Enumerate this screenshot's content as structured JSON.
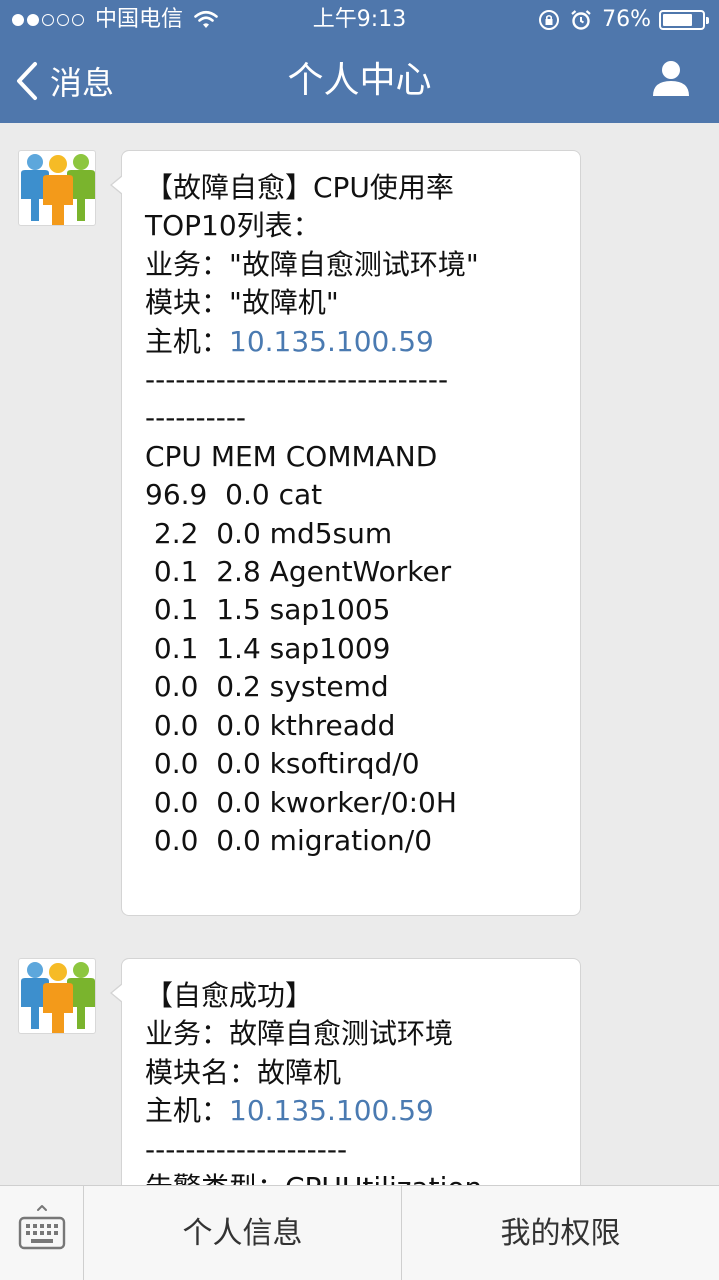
{
  "status_bar": {
    "carrier": "中国电信",
    "time": "上午9:13",
    "battery_percent": "76%",
    "battery_level": 0.76,
    "signal_bars_filled": 2,
    "signal_bars_total": 5
  },
  "navbar": {
    "back_label": "消息",
    "title": "个人中心",
    "user_icon": "person-icon"
  },
  "messages": [
    {
      "lines": [
        {
          "text": "【故障自愈】CPU使用率"
        },
        {
          "text": "TOP10列表："
        },
        {
          "text": "业务：\"故障自愈测试环境\""
        },
        {
          "text": "模块：\"故障机\""
        },
        {
          "prefix": "主机：",
          "link": "10.135.100.59"
        },
        {
          "text": "------------------------------"
        },
        {
          "text": "----------"
        },
        {
          "text": "CPU MEM COMMAND"
        },
        {
          "text": "96.9  0.0 cat"
        },
        {
          "text": " 2.2  0.0 md5sum"
        },
        {
          "text": " 0.1  2.8 AgentWorker"
        },
        {
          "text": " 0.1  1.5 sap1005"
        },
        {
          "text": " 0.1  1.4 sap1009"
        },
        {
          "text": " 0.0  0.2 systemd"
        },
        {
          "text": " 0.0  0.0 kthreadd"
        },
        {
          "text": " 0.0  0.0 ksoftirqd/0"
        },
        {
          "text": " 0.0  0.0 kworker/0:0H"
        },
        {
          "text": " 0.0  0.0 migration/0"
        }
      ]
    },
    {
      "lines": [
        {
          "text": "【自愈成功】"
        },
        {
          "text": "业务：故障自愈测试环境"
        },
        {
          "text": "模块名：故障机"
        },
        {
          "prefix": "主机：",
          "link": "10.135.100.59"
        },
        {
          "text": "--------------------"
        },
        {
          "text": "告警类型：CPUUtilization"
        }
      ]
    }
  ],
  "bottom_menu": {
    "keyboard_icon": "keyboard-icon",
    "item_1": "个人信息",
    "item_2": "我的权限"
  },
  "colors": {
    "navbar": "#4f77ac",
    "link": "#4a7ab1",
    "background": "#ebebeb"
  }
}
